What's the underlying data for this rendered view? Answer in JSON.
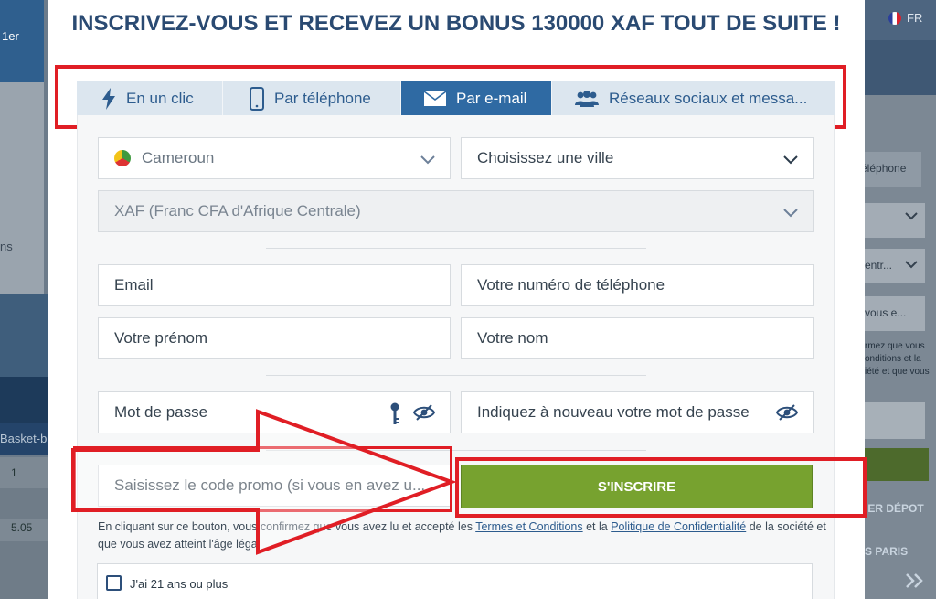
{
  "background": {
    "left_top_text": "1er",
    "left_card_text": "ns",
    "left_tab_text": "Basket-b",
    "left_odds": [
      "1",
      "5.05"
    ],
    "right_lang": "FR",
    "right_phone_text": "éléphone",
    "right_select_text": "entr...",
    "right_field_text": "vous e...",
    "right_small_lines": [
      "rmez que vous",
      "onditions et la",
      "iété et que vous"
    ],
    "right_button_text": "IER DÉPOT",
    "right_paris_text": "S PARIS",
    "right_more_icon": "double-chevron-right-icon"
  },
  "modal": {
    "title": "INSCRIVEZ-VOUS ET RECEVEZ UN BONUS 130000 XAF TOUT DE SUITE !",
    "tabs": [
      {
        "label": "En un clic",
        "icon": "lightning-icon",
        "active": false
      },
      {
        "label": "Par téléphone",
        "icon": "phone-icon",
        "active": false
      },
      {
        "label": "Par e-mail",
        "icon": "envelope-icon",
        "active": true
      },
      {
        "label": "Réseaux sociaux et messa...",
        "icon": "users-icon",
        "active": false
      }
    ],
    "form": {
      "country": "Cameroun",
      "city_placeholder": "Choisissez une ville",
      "currency": "XAF (Franc CFA d'Afrique Centrale)",
      "email_placeholder": "Email",
      "phone_placeholder": "Votre numéro de téléphone",
      "firstname_placeholder": "Votre prénom",
      "lastname_placeholder": "Votre nom",
      "password_placeholder": "Mot de passe",
      "password_repeat_placeholder": "Indiquez à nouveau votre mot de passe",
      "promo_placeholder": "Saisissez le code promo (si vous en avez u...",
      "submit_label": "S'INSCRIRE"
    },
    "legal": {
      "part1": "En cliquant sur ce bouton, vous confirmez que vous avez lu et accepté les ",
      "terms_link": "Termes et Conditions",
      "part2": " et la ",
      "privacy_link": "Politique de Confidentialité",
      "part3": " de la société et que vous avez atteint l'âge légal"
    },
    "age_checkbox_label": "J'ai 21 ans ou plus"
  },
  "colors": {
    "accent_blue": "#2f6aa3",
    "title_blue": "#2a4a72",
    "submit_green": "#77a22f",
    "highlight_red": "#e01e25"
  }
}
